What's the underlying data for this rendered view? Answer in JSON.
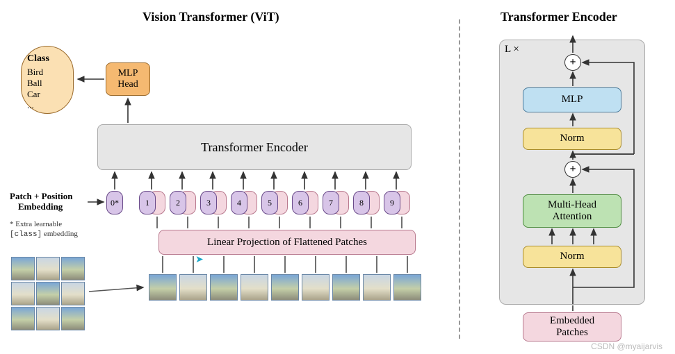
{
  "left": {
    "title": "Vision Transformer (ViT)",
    "class_box": {
      "heading": "Class",
      "items": [
        "Bird",
        "Ball",
        "Car",
        "..."
      ]
    },
    "mlp_head": "MLP\nHead",
    "transformer_encoder": "Transformer Encoder",
    "patch_pos_label_line1": "Patch + Position",
    "patch_pos_label_line2": "Embedding",
    "extra_note_line1": "* Extra learnable",
    "extra_note_code": "[class]",
    "extra_note_line2": " embedding",
    "token0": "0*",
    "tokens": [
      "1",
      "2",
      "3",
      "4",
      "5",
      "6",
      "7",
      "8",
      "9"
    ],
    "linear_projection": "Linear Projection of Flattened Patches"
  },
  "right": {
    "title": "Transformer Encoder",
    "lx": "L ×",
    "mlp": "MLP",
    "norm": "Norm",
    "mha": "Multi-Head\nAttention",
    "embedded_patches": "Embedded\nPatches",
    "plus": "+"
  },
  "watermark": "CSDN @myaijarvis"
}
